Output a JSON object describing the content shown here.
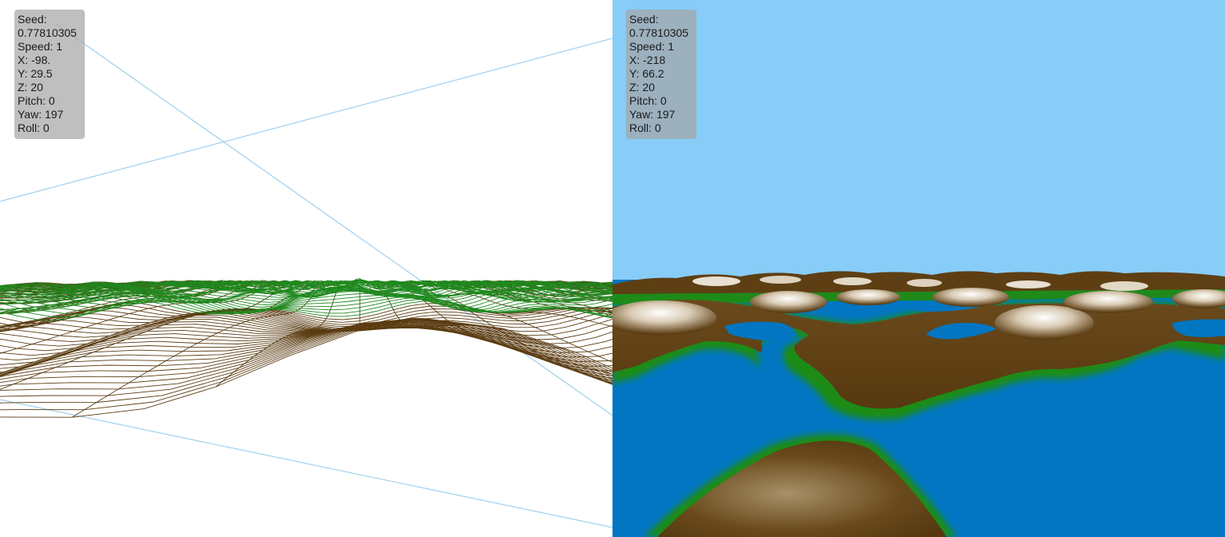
{
  "views": [
    {
      "name": "wireframe",
      "hud": {
        "seed_label": "Seed:",
        "seed_value": "0.77810305",
        "speed": "Speed: 1",
        "x": "X: -98.",
        "y": "Y: 29.5",
        "z": "Z: 20",
        "pitch": "Pitch: 0",
        "yaw": "Yaw: 197",
        "roll": "Roll: 0"
      }
    },
    {
      "name": "solid",
      "hud": {
        "seed_label": "Seed:",
        "seed_value": "0.77810305",
        "speed": "Speed: 1",
        "x": "X: -218",
        "y": "Y: 66.2",
        "z": "Z: 20",
        "pitch": "Pitch: 0",
        "yaw": "Yaw: 197",
        "roll": "Roll: 0"
      }
    }
  ],
  "colors": {
    "sky": "#87cdf8",
    "water": "#0276c2",
    "land": "#5e3f14",
    "grass": "#1a8a16",
    "snow": "#ffffff",
    "wire_brown": "#5b3c12",
    "wire_green": "#1f8a1f",
    "axis_blue": "#9fd0ee"
  }
}
